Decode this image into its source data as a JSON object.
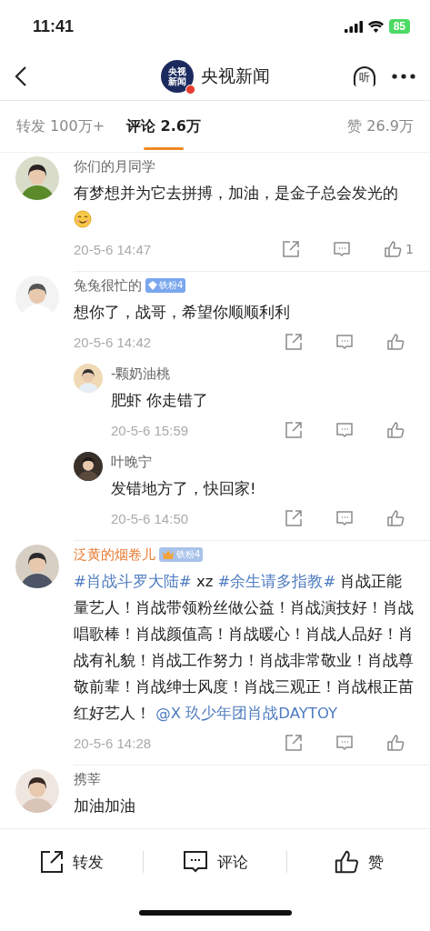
{
  "status_bar": {
    "time": "11:41",
    "battery": "85"
  },
  "nav": {
    "logo_text": [
      "央视",
      "新闻"
    ],
    "title": "央视新闻",
    "listen": "听"
  },
  "tabs": [
    {
      "label": "转发 100万+",
      "selected": false
    },
    {
      "label": "评论 2.6万",
      "selected": true
    },
    {
      "label": "赞 26.9万",
      "selected": false
    }
  ],
  "comments": [
    {
      "user": "你们的月同学",
      "highlighted_name": false,
      "body": [
        {
          "kind": "text",
          "text": "有梦想并为它去拼搏，加油，是金子总会发光的"
        },
        {
          "kind": "emoji"
        }
      ],
      "time": "20-5-6 14:47",
      "likes": "1"
    },
    {
      "user": "兔兔很忙的",
      "highlighted_name": false,
      "badge": {
        "kind": "diamond",
        "text": "铁粉4"
      },
      "body": [
        {
          "kind": "text",
          "text": "想你了，战哥，希望你顺顺利利"
        }
      ],
      "time": "20-5-6 14:42",
      "replies": [
        {
          "user": "-颗奶油桃",
          "body": [
            {
              "kind": "text",
              "text": "肥虾 你走错了"
            }
          ],
          "time": "20-5-6 15:59"
        },
        {
          "user": "叶晚宁",
          "body": [
            {
              "kind": "text",
              "text": "发错地方了，快回家!"
            }
          ],
          "time": "20-5-6 14:50"
        }
      ]
    },
    {
      "user": "泛黄的烟卷儿",
      "highlighted_name": true,
      "badge": {
        "kind": "crown",
        "text": "铁粉4"
      },
      "body": [
        {
          "kind": "link",
          "text": "#肖战斗罗大陆#"
        },
        {
          "kind": "text",
          "text": " xz "
        },
        {
          "kind": "link",
          "text": "#余生请多指教#"
        },
        {
          "kind": "text",
          "text": " 肖战正能量艺人！肖战带领粉丝做公益！肖战演技好！肖战唱歌棒！肖战颜值高！肖战暖心！肖战人品好！肖战有礼貌！肖战工作努力！肖战非常敬业！肖战尊敬前辈！肖战绅士风度！肖战三观正！肖战根正苗红好艺人！ "
        },
        {
          "kind": "link",
          "text": "@X 玖少年团肖战DAYTOY"
        }
      ],
      "time": "20-5-6 14:28"
    },
    {
      "user": "携莘",
      "highlighted_name": false,
      "body": [
        {
          "kind": "text",
          "text": "加油加油"
        }
      ]
    }
  ],
  "bottom_bar": [
    {
      "kind": "share",
      "label": "转发"
    },
    {
      "kind": "comment",
      "label": "评论"
    },
    {
      "kind": "like",
      "label": "赞"
    }
  ]
}
